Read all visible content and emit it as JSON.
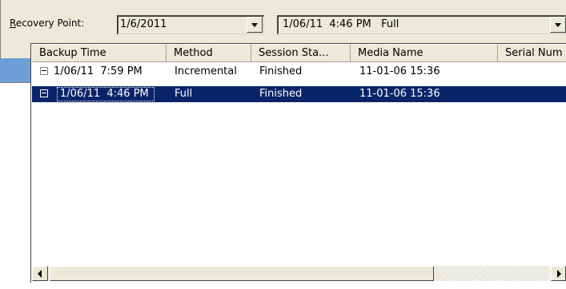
{
  "recovery_point": {
    "label_prefix": "R",
    "label_rest": "ecovery Point:",
    "date_value": "1/6/2011",
    "session_value": "1/06/11  4:46 PM   Full"
  },
  "list": {
    "columns": [
      "Backup Time",
      "Method",
      "Session Sta...",
      "Media Name",
      "Serial Num"
    ],
    "rows": [
      {
        "backup_time": "1/06/11  7:59 PM",
        "method": "Incremental",
        "session_status": "Finished",
        "media_name": "11-01-06 15:36",
        "serial_number": "",
        "selected": false
      },
      {
        "backup_time": "1/06/11  4:46 PM",
        "method": "Full",
        "session_status": "Finished",
        "media_name": "11-01-06 15:36",
        "serial_number": "",
        "selected": true
      }
    ]
  },
  "colors": {
    "selection": "#0a246a",
    "panel": "#ece9d8",
    "accent_blue": "#6d9ed8"
  }
}
